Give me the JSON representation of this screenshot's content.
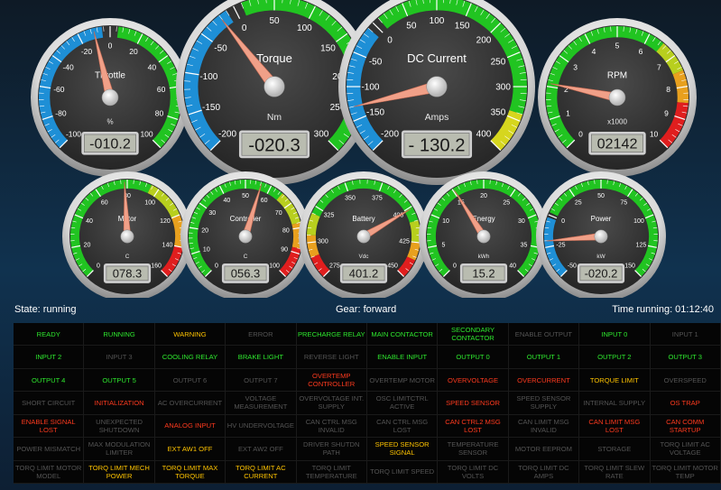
{
  "gauges": [
    {
      "id": "throttle",
      "title": "Throttle",
      "unit": "%",
      "readout": "-010.2",
      "value": -10.2,
      "min": -100,
      "max": 100,
      "ticks": [
        "-100",
        "-80",
        "-60",
        "-40",
        "-20",
        "0",
        "20",
        "40",
        "60",
        "80",
        "100"
      ],
      "bands": [
        {
          "from": -100,
          "to": -5,
          "color": "#1e8fd6"
        },
        {
          "from": 5,
          "to": 100,
          "color": "#21c421"
        }
      ]
    },
    {
      "id": "torque",
      "title": "Torque",
      "unit": "Nm",
      "readout": "-020.3",
      "value": -20.3,
      "min": -200,
      "max": 300,
      "ticks": [
        "-200",
        "-150",
        "-100",
        "-50",
        "0",
        "50",
        "100",
        "150",
        "200",
        "250",
        "300"
      ],
      "bands": [
        {
          "from": -200,
          "to": -10,
          "color": "#1e8fd6"
        },
        {
          "from": 10,
          "to": 300,
          "color": "#21c421"
        }
      ]
    },
    {
      "id": "dc-current",
      "title": "DC Current",
      "unit": "Amps",
      "readout": "- 130.2",
      "value": -130.2,
      "min": -200,
      "max": 400,
      "ticks": [
        "-200",
        "-150",
        "-100",
        "-50",
        "0",
        "50",
        "100",
        "150",
        "200",
        "250",
        "300",
        "350",
        "400"
      ],
      "bands": [
        {
          "from": -200,
          "to": -10,
          "color": "#1e8fd6"
        },
        {
          "from": 10,
          "to": 340,
          "color": "#21c421"
        },
        {
          "from": 340,
          "to": 400,
          "color": "#d6d61e"
        }
      ]
    },
    {
      "id": "rpm",
      "title": "RPM",
      "unit": "x1000",
      "readout": "02142",
      "value": 2.1,
      "min": 0,
      "max": 10,
      "ticks": [
        "0",
        "1",
        "2",
        "3",
        "4",
        "5",
        "6",
        "7",
        "8",
        "9",
        "10"
      ],
      "bands": [
        {
          "from": 0,
          "to": 6.5,
          "color": "#21c421"
        },
        {
          "from": 6.5,
          "to": 7.5,
          "color": "#b8cf1e"
        },
        {
          "from": 7.5,
          "to": 8.5,
          "color": "#e8a01e"
        },
        {
          "from": 8.5,
          "to": 10,
          "color": "#e01e1e"
        }
      ]
    },
    {
      "id": "motor",
      "title": "Motor",
      "unit": "C",
      "readout": "078.3",
      "value": 78.3,
      "min": 0,
      "max": 160,
      "ticks": [
        "0",
        "20",
        "40",
        "60",
        "80",
        "100",
        "120",
        "140",
        "160"
      ],
      "bands": [
        {
          "from": 0,
          "to": 95,
          "color": "#21c421"
        },
        {
          "from": 95,
          "to": 120,
          "color": "#b8cf1e"
        },
        {
          "from": 120,
          "to": 140,
          "color": "#e8a01e"
        },
        {
          "from": 140,
          "to": 160,
          "color": "#e01e1e"
        }
      ]
    },
    {
      "id": "controller",
      "title": "Controller",
      "unit": "C",
      "readout": "056.3",
      "value": 56.3,
      "min": 0,
      "max": 100,
      "ticks": [
        "0",
        "10",
        "20",
        "30",
        "40",
        "50",
        "60",
        "70",
        "80",
        "90",
        "100"
      ],
      "bands": [
        {
          "from": 0,
          "to": 65,
          "color": "#21c421"
        },
        {
          "from": 65,
          "to": 78,
          "color": "#b8cf1e"
        },
        {
          "from": 78,
          "to": 88,
          "color": "#e8a01e"
        },
        {
          "from": 88,
          "to": 100,
          "color": "#e01e1e"
        }
      ]
    },
    {
      "id": "battery",
      "title": "Battery",
      "unit": "Vdc",
      "readout": "401.2",
      "value": 401.2,
      "min": 275,
      "max": 450,
      "ticks": [
        "275",
        "300",
        "325",
        "350",
        "375",
        "400",
        "425",
        "450"
      ],
      "bands": [
        {
          "from": 275,
          "to": 290,
          "color": "#e01e1e"
        },
        {
          "from": 290,
          "to": 305,
          "color": "#e8a01e"
        },
        {
          "from": 305,
          "to": 320,
          "color": "#b8cf1e"
        },
        {
          "from": 320,
          "to": 410,
          "color": "#21c421"
        },
        {
          "from": 410,
          "to": 425,
          "color": "#b8cf1e"
        },
        {
          "from": 425,
          "to": 437,
          "color": "#e8a01e"
        },
        {
          "from": 437,
          "to": 450,
          "color": "#e01e1e"
        }
      ]
    },
    {
      "id": "energy",
      "title": "Energy",
      "unit": "kWh",
      "readout": "15.2",
      "value": 15.2,
      "min": 0,
      "max": 40,
      "ticks": [
        "0",
        "5",
        "10",
        "15",
        "20",
        "25",
        "30",
        "35",
        "40"
      ],
      "bands": [
        {
          "from": 0,
          "to": 40,
          "color": "#21c421"
        }
      ]
    },
    {
      "id": "power",
      "title": "Power",
      "unit": "kW",
      "readout": "-020.2",
      "value": -20.2,
      "min": -50,
      "max": 150,
      "ticks": [
        "-50",
        "-25",
        "0",
        "25",
        "50",
        "75",
        "100",
        "125",
        "150"
      ],
      "bands": [
        {
          "from": -50,
          "to": -2,
          "color": "#1e8fd6"
        },
        {
          "from": 2,
          "to": 150,
          "color": "#21c421"
        }
      ]
    }
  ],
  "status_bar": {
    "state": "State: running",
    "gear": "Gear: forward",
    "time_running": "Time running: 01:12:40"
  },
  "status_colors": {
    "green": "#2ee82e",
    "red": "#ff3a1e",
    "yellow": "#ffc400",
    "gray": "#545454"
  },
  "status_cells": [
    {
      "label": "READY",
      "state": "green"
    },
    {
      "label": "RUNNING",
      "state": "green"
    },
    {
      "label": "WARNING",
      "state": "yellow"
    },
    {
      "label": "ERROR",
      "state": "gray"
    },
    {
      "label": "PRECHARGE RELAY",
      "state": "green"
    },
    {
      "label": "MAIN CONTACTOR",
      "state": "green"
    },
    {
      "label": "SECONDARY CONTACTOR",
      "state": "green"
    },
    {
      "label": "ENABLE OUTPUT",
      "state": "gray"
    },
    {
      "label": "INPUT 0",
      "state": "green"
    },
    {
      "label": "INPUT 1",
      "state": "gray"
    },
    {
      "label": "INPUT 2",
      "state": "green"
    },
    {
      "label": "INPUT 3",
      "state": "gray"
    },
    {
      "label": "COOLING RELAY",
      "state": "green"
    },
    {
      "label": "BRAKE LIGHT",
      "state": "green"
    },
    {
      "label": "REVERSE LIGHT",
      "state": "gray"
    },
    {
      "label": "ENABLE INPUT",
      "state": "green"
    },
    {
      "label": "OUTPUT 0",
      "state": "green"
    },
    {
      "label": "OUTPUT 1",
      "state": "green"
    },
    {
      "label": "OUTPUT 2",
      "state": "green"
    },
    {
      "label": "OUTPUT 3",
      "state": "green"
    },
    {
      "label": "OUTPUT 4",
      "state": "green"
    },
    {
      "label": "OUTPUT 5",
      "state": "green"
    },
    {
      "label": "OUTPUT 6",
      "state": "gray"
    },
    {
      "label": "OUTPUT 7",
      "state": "gray"
    },
    {
      "label": "OVERTEMP CONTROLLER",
      "state": "red"
    },
    {
      "label": "OVERTEMP MOTOR",
      "state": "gray"
    },
    {
      "label": "OVERVOLTAGE",
      "state": "red"
    },
    {
      "label": "OVERCURRENT",
      "state": "red"
    },
    {
      "label": "TORQUE LIMIT",
      "state": "yellow"
    },
    {
      "label": "OVERSPEED",
      "state": "gray"
    },
    {
      "label": "SHORT CIRCUIT",
      "state": "gray"
    },
    {
      "label": "INITIALIZATION",
      "state": "red"
    },
    {
      "label": "AC OVERCURRENT",
      "state": "gray"
    },
    {
      "label": "VOLTAGE MEASUREMENT",
      "state": "gray"
    },
    {
      "label": "OVERVOLTAGE INT. SUPPLY",
      "state": "gray"
    },
    {
      "label": "OSC LIMITCTRL ACTIVE",
      "state": "gray"
    },
    {
      "label": "SPEED SENSOR",
      "state": "red"
    },
    {
      "label": "SPEED SENSOR SUPPLY",
      "state": "gray"
    },
    {
      "label": "INTERNAL SUPPLY",
      "state": "gray"
    },
    {
      "label": "OS TRAP",
      "state": "red"
    },
    {
      "label": "ENABLE SIGNAL LOST",
      "state": "red"
    },
    {
      "label": "UNEXPECTED SHUTDOWN",
      "state": "gray"
    },
    {
      "label": "ANALOG INPUT",
      "state": "red"
    },
    {
      "label": "HV UNDERVOLTAGE",
      "state": "gray"
    },
    {
      "label": "CAN CTRL MSG INVALID",
      "state": "gray"
    },
    {
      "label": "CAN CTRL MSG LOST",
      "state": "gray"
    },
    {
      "label": "CAN CTRL2 MSG LOST",
      "state": "red"
    },
    {
      "label": "CAN LIMIT MSG INVALID",
      "state": "gray"
    },
    {
      "label": "CAN LIMIT MSG LOST",
      "state": "red"
    },
    {
      "label": "CAN COMM STARTUP",
      "state": "red"
    },
    {
      "label": "POWER MISMATCH",
      "state": "gray"
    },
    {
      "label": "MAX MODULATION LIMITER",
      "state": "gray"
    },
    {
      "label": "EXT AW1 OFF",
      "state": "yellow"
    },
    {
      "label": "EXT AW2 OFF",
      "state": "gray"
    },
    {
      "label": "DRIVER SHUTDN PATH",
      "state": "gray"
    },
    {
      "label": "SPEED SENSOR SIGNAL",
      "state": "yellow"
    },
    {
      "label": "TEMPERATURE SENSOR",
      "state": "gray"
    },
    {
      "label": "MOTOR EEPROM",
      "state": "gray"
    },
    {
      "label": "STORAGE",
      "state": "gray"
    },
    {
      "label": "TORQ LIMIT AC VOLTAGE",
      "state": "gray"
    },
    {
      "label": "TORQ LIMIT MOTOR MODEL",
      "state": "gray"
    },
    {
      "label": "TORQ LIMIT MECH POWER",
      "state": "yellow"
    },
    {
      "label": "TORQ LIMIT MAX TORQUE",
      "state": "yellow"
    },
    {
      "label": "TORQ LIMIT AC CURRENT",
      "state": "yellow"
    },
    {
      "label": "TORQ LIMIT TEMPERATURE",
      "state": "gray"
    },
    {
      "label": "TORQ LIMIT SPEED",
      "state": "gray"
    },
    {
      "label": "TORQ LIMIT DC VOLTS",
      "state": "gray"
    },
    {
      "label": "TORQ LIMIT DC AMPS",
      "state": "gray"
    },
    {
      "label": "TORQ LIMIT SLEW RATE",
      "state": "gray"
    },
    {
      "label": "TORQ LIMIT MOTOR TEMP",
      "state": "gray"
    }
  ]
}
